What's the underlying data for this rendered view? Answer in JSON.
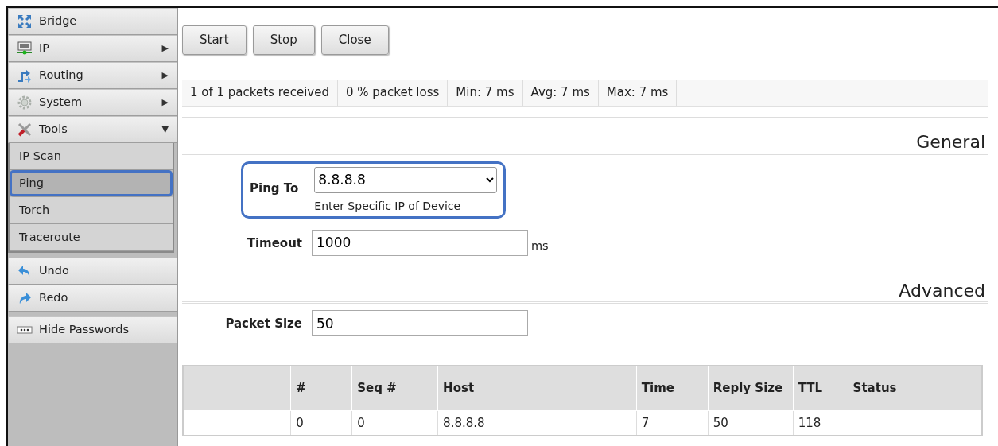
{
  "sidebar": {
    "menu": [
      {
        "label": "Bridge"
      },
      {
        "label": "IP",
        "arrow": "▶"
      },
      {
        "label": "Routing",
        "arrow": "▶"
      },
      {
        "label": "System",
        "arrow": "▶"
      },
      {
        "label": "Tools",
        "arrow": "▼",
        "expanded": true,
        "children": [
          {
            "label": "IP Scan",
            "selected": false
          },
          {
            "label": "Ping",
            "selected": true
          },
          {
            "label": "Torch",
            "selected": false
          },
          {
            "label": "Traceroute",
            "selected": false
          }
        ]
      }
    ],
    "actions": [
      {
        "label": "Undo"
      },
      {
        "label": "Redo"
      }
    ],
    "toggles": [
      {
        "label": "Hide Passwords"
      }
    ]
  },
  "toolbar": {
    "buttons": [
      "Start",
      "Stop",
      "Close"
    ]
  },
  "stats": [
    "1 of 1 packets received",
    "0 % packet loss",
    "Min: 7 ms",
    "Avg: 7 ms",
    "Max: 7 ms"
  ],
  "sections": [
    {
      "title": "General",
      "fields": [
        {
          "kind": "select",
          "label": "Ping To",
          "value": "8.8.8.8",
          "hint": "Enter Specific IP of Device",
          "highlighted": true
        },
        {
          "kind": "text",
          "label": "Timeout",
          "value": "1000",
          "unit": "ms"
        }
      ]
    },
    {
      "title": "Advanced",
      "fields": [
        {
          "kind": "text",
          "label": "Packet Size",
          "value": "50"
        }
      ]
    }
  ],
  "table": {
    "columns": [
      "#",
      "Seq #",
      "Host",
      "Time",
      "Reply Size",
      "TTL",
      "Status"
    ],
    "rows": [
      [
        "0",
        "0",
        "8.8.8.8",
        "7",
        "50",
        "118"
      ]
    ]
  }
}
